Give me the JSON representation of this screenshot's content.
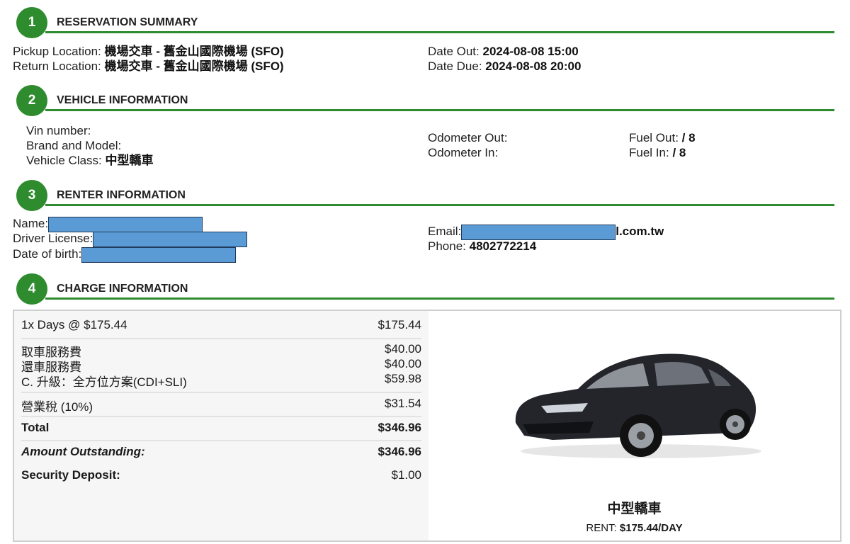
{
  "sections": {
    "s1": {
      "num": "1",
      "title": "RESERVATION SUMMARY"
    },
    "s2": {
      "num": "2",
      "title": "VEHICLE INFORMATION"
    },
    "s3": {
      "num": "3",
      "title": "RENTER INFORMATION"
    },
    "s4": {
      "num": "4",
      "title": "CHARGE INFORMATION"
    }
  },
  "reservation": {
    "pickup_label": "Pickup Location:",
    "pickup_value": "機場交車 - 舊金山國際機場 (SFO)",
    "return_label": "Return Location:",
    "return_value": "機場交車 - 舊金山國際機場 (SFO)",
    "date_out_label": "Date Out:",
    "date_out_value": "2024-08-08 15:00",
    "date_due_label": "Date Due:",
    "date_due_value": "2024-08-08 20:00"
  },
  "vehicle": {
    "vin_label": "Vin number:",
    "brand_label": "Brand and Model:",
    "class_label": "Vehicle Class:",
    "class_value": "中型轎車",
    "odo_out_label": "Odometer Out:",
    "odo_in_label": "Odometer In:",
    "fuel_out_label": "Fuel Out:",
    "fuel_out_value": "/ 8",
    "fuel_in_label": "Fuel In:",
    "fuel_in_value": "/ 8"
  },
  "renter": {
    "name_label": "Name:",
    "license_label": "Driver License:",
    "dob_label": "Date of birth:",
    "email_label": "Email:",
    "email_suffix": "l.com.tw",
    "phone_label": "Phone:",
    "phone_value": "4802772214"
  },
  "charges": {
    "days": {
      "label": "1x Days @ $175.44",
      "amount": "$175.44"
    },
    "pickup_fee": {
      "label": "取車服務費",
      "amount": "$40.00"
    },
    "return_fee": {
      "label": "還車服務費",
      "amount": "$40.00"
    },
    "upgrade": {
      "label": "C. 升級：全方位方案(CDI+SLI)",
      "amount": "$59.98"
    },
    "tax": {
      "label": "營業稅 (10%)",
      "amount": "$31.54"
    },
    "total": {
      "label": "Total",
      "amount": "$346.96"
    },
    "outstanding": {
      "label": "Amount Outstanding:",
      "amount": "$346.96"
    },
    "deposit": {
      "label": "Security Deposit:",
      "amount": "$1.00"
    }
  },
  "car": {
    "name": "中型轎車",
    "rent_prefix": "RENT: ",
    "rent_value": "$175.44",
    "rent_suffix": "/DAY",
    "car_color": "#23252b"
  }
}
